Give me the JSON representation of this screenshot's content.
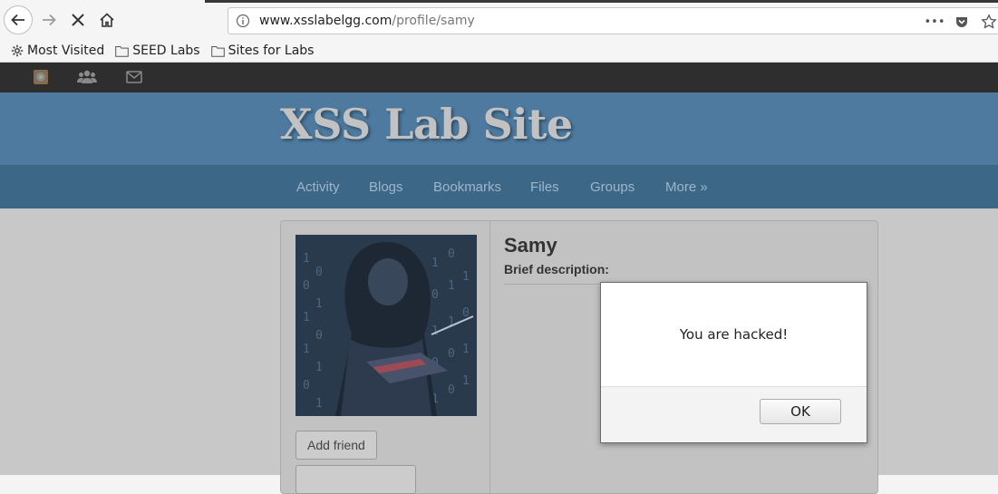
{
  "browser": {
    "url_host": "www.xsslabelgg.com",
    "url_path": "/profile/samy",
    "page_actions_icon": "•••",
    "bookmarks": [
      {
        "label": "Most Visited",
        "icon": "gear-icon"
      },
      {
        "label": "SEED Labs",
        "icon": "folder-icon"
      },
      {
        "label": "Sites for Labs",
        "icon": "folder-icon"
      }
    ]
  },
  "site": {
    "title": "XSS Lab Site",
    "menu": [
      "Activity",
      "Blogs",
      "Bookmarks",
      "Files",
      "Groups",
      "More »"
    ]
  },
  "profile": {
    "name": "Samy",
    "brief_label": "Brief description:",
    "add_friend": "Add friend"
  },
  "alert": {
    "message": "You are hacked!",
    "ok_label": "OK"
  },
  "colors": {
    "header": "#4e7a9f",
    "menu": "#3d6787",
    "topbar": "#2e2e2e",
    "overlay": "#c8c8c8"
  }
}
